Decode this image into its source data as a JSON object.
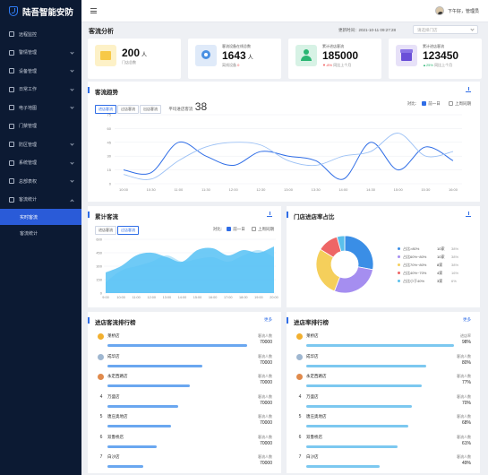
{
  "app": {
    "title": "陆吾智能安防"
  },
  "sidebar": {
    "items": [
      {
        "label": "远程监控"
      },
      {
        "label": "警情管理"
      },
      {
        "label": "设备管理"
      },
      {
        "label": "日常工作"
      },
      {
        "label": "电子地图"
      },
      {
        "label": "门禁管理"
      },
      {
        "label": "防区管理"
      },
      {
        "label": "系统管理"
      },
      {
        "label": "总部表权"
      },
      {
        "label": "客流统计"
      }
    ],
    "subitems": [
      {
        "label": "实时客流"
      },
      {
        "label": "客流统计"
      }
    ]
  },
  "topbar": {
    "greeting": "下午好，管理员"
  },
  "header": {
    "title": "客流分析",
    "update_label": "更新时间：",
    "update_time": "2021-10-11 09:27:28",
    "store_placeholder": "请选择门店"
  },
  "kpis": [
    {
      "label": "",
      "value": "200",
      "unit": "人",
      "sub": "门店总数",
      "sub_value": "",
      "color": "#f7c948"
    },
    {
      "label": "客流设备在线总数",
      "value": "1643",
      "unit": "人",
      "sub": "离线设备",
      "sub_value": "0",
      "color": "#4a90e2"
    },
    {
      "label": "累计进店客流",
      "value": "185000",
      "unit": "",
      "sub": "同比上个月",
      "sub_value": "▼-8%",
      "color": "#2bb673"
    },
    {
      "label": "累计进店客流",
      "value": "123450",
      "unit": "",
      "sub": "同比上个月",
      "sub_value": "▲25%",
      "color": "#6a4fd8"
    }
  ],
  "trend": {
    "title": "客流趋势",
    "tabs": [
      "进店客流",
      "过店客流",
      "出店客流"
    ],
    "avg_label": "平均进店客流",
    "avg_value": "38",
    "compare_label": "对比:",
    "opt1": "前一日",
    "opt2": "上周同期"
  },
  "cumulative": {
    "title": "累计客流",
    "tabs": [
      "进店客流",
      "过店客流"
    ],
    "compare_label": "对比:",
    "opt1": "前一日",
    "opt2": "上周同期"
  },
  "ratio": {
    "title": "门店进店率占比",
    "legend": [
      {
        "label": "占比>80%",
        "count": "10家",
        "pct": "38%",
        "color": "#3a8ee6"
      },
      {
        "label": "占比60%~80%",
        "count": "10家",
        "pct": "38%",
        "color": "#a58ef0"
      },
      {
        "label": "占比70%~80%",
        "count": "8家",
        "pct": "38%",
        "color": "#f5cf5b"
      },
      {
        "label": "占比40%~70%",
        "count": "4家",
        "pct": "16%",
        "color": "#ee6666"
      },
      {
        "label": "占比小于40%",
        "count": "3家",
        "pct": "6%",
        "color": "#5bc0eb"
      }
    ]
  },
  "rank1": {
    "title": "进店客流排行榜",
    "more": "更多",
    "items": [
      {
        "num": "1",
        "name": "莱桥店",
        "label": "客流人数",
        "value": "70000",
        "pct": 0.93
      },
      {
        "num": "2",
        "name": "成华店",
        "label": "客流人数",
        "value": "70000",
        "pct": 0.63
      },
      {
        "num": "3",
        "name": "永定西路店",
        "label": "客流人数",
        "value": "70000",
        "pct": 0.55
      },
      {
        "num": "4",
        "name": "万盛店",
        "label": "客流人数",
        "value": "70000",
        "pct": 0.47
      },
      {
        "num": "5",
        "name": "唐庄奥地店",
        "label": "客流人数",
        "value": "70000",
        "pct": 0.42
      },
      {
        "num": "6",
        "name": "双鲁桥店",
        "label": "客流人数",
        "value": "70000",
        "pct": 0.33
      },
      {
        "num": "7",
        "name": "白沙店",
        "label": "客流人数",
        "value": "70000",
        "pct": 0.24
      }
    ]
  },
  "rank2": {
    "title": "进店率排行榜",
    "more": "更多",
    "items": [
      {
        "num": "1",
        "name": "莱桥店",
        "label": "进店率",
        "value": "98%",
        "pct": 0.98
      },
      {
        "num": "2",
        "name": "成华店",
        "label": "客流人数",
        "value": "80%",
        "pct": 0.8
      },
      {
        "num": "3",
        "name": "永定西路店",
        "label": "客流人数",
        "value": "77%",
        "pct": 0.77
      },
      {
        "num": "4",
        "name": "万盛店",
        "label": "客流人数",
        "value": "70%",
        "pct": 0.7
      },
      {
        "num": "5",
        "name": "唐庄奥地店",
        "label": "客流人数",
        "value": "68%",
        "pct": 0.68
      },
      {
        "num": "6",
        "name": "双鲁桥店",
        "label": "客流人数",
        "value": "61%",
        "pct": 0.61
      },
      {
        "num": "7",
        "name": "白沙店",
        "label": "客流人数",
        "value": "49%",
        "pct": 0.49
      }
    ]
  },
  "chart_data": [
    {
      "type": "line",
      "title": "客流趋势",
      "x": [
        "10:00",
        "10:30",
        "11:00",
        "11:30",
        "12:00",
        "12:30",
        "13:00",
        "13:30",
        "14:00",
        "14:30",
        "15:00",
        "15:30",
        "16:00"
      ],
      "ylim": [
        0,
        70
      ],
      "yticks": [
        0,
        15,
        30,
        45,
        60,
        75
      ],
      "series": [
        {
          "name": "",
          "values": [
            15,
            12,
            45,
            30,
            20,
            35,
            30,
            25,
            5,
            45,
            15,
            40,
            25
          ],
          "color": "#2f6de6"
        },
        {
          "name": "",
          "values": [
            10,
            5,
            25,
            40,
            45,
            42,
            25,
            20,
            30,
            35,
            55,
            30,
            35
          ],
          "color": "#9cc1f5"
        }
      ]
    },
    {
      "type": "area",
      "title": "累计客流",
      "x": [
        "9:00",
        "10:00",
        "11:00",
        "12:00",
        "13:00",
        "14:00",
        "15:00",
        "16:00",
        "17:00",
        "18:00",
        "19:00",
        "20:00"
      ],
      "ylim": [
        0,
        600
      ],
      "yticks": [
        0,
        150,
        300,
        450,
        600
      ],
      "series": [
        {
          "name": "",
          "values": [
            230,
            300,
            420,
            450,
            400,
            350,
            480,
            500,
            420,
            480,
            450,
            520
          ],
          "color": "#56c1f5"
        },
        {
          "name": "",
          "values": [
            120,
            250,
            300,
            350,
            420,
            350,
            380,
            400,
            350,
            420,
            480,
            400
          ],
          "color": "#a0dcf8"
        }
      ]
    },
    {
      "type": "pie",
      "title": "门店进店率占比",
      "categories": [
        "占比>80%",
        "占比60%~80%",
        "占比70%~80%",
        "占比40%~70%",
        "占比小于40%"
      ],
      "values": [
        38,
        38,
        38,
        16,
        6
      ]
    }
  ]
}
